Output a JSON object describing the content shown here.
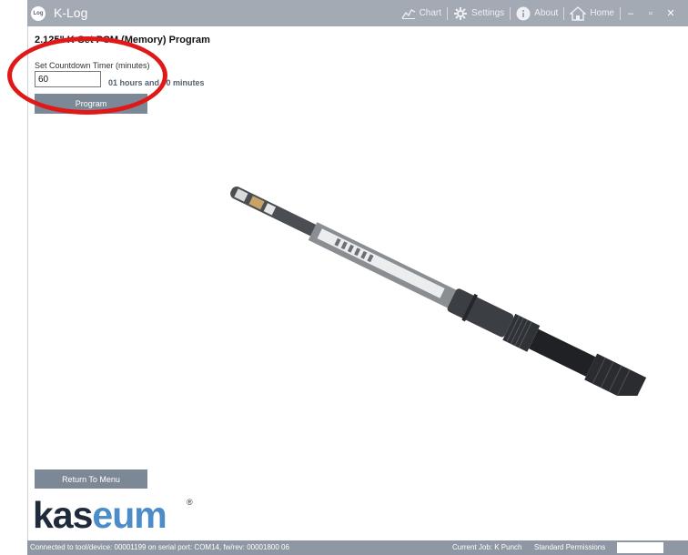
{
  "app": {
    "logo_text": "Log",
    "title": "K-Log"
  },
  "nav": {
    "chart": "Chart",
    "settings": "Settings",
    "about": "About",
    "home": "Home",
    "minimize": "–",
    "maximize": "▫",
    "close": "✕"
  },
  "page": {
    "title": "2.125\" K-Set PCM (Memory) Program",
    "timer_label": "Set Countdown Timer (minutes)",
    "timer_value": "60",
    "duration_text": "01 hours and 00 minutes",
    "program_button": "Program",
    "return_button": "Return To Menu"
  },
  "brand": {
    "part1": "kas",
    "part2": "eum",
    "reg": "®"
  },
  "status": {
    "connection": "Connected to tool/device: 00001199 on serial port: COM14, fw/rev: 00001800 06",
    "job": "Current Job: K Punch",
    "permissions": "Standard Permissions"
  },
  "colors": {
    "titlebar": "#a3aab4",
    "button": "#7d8897",
    "statusbar": "#8e97a3",
    "annotation": "#e01818",
    "brand_dark": "#1f2b3a",
    "brand_blue": "#4b8cc9"
  },
  "icons": [
    "chart-icon",
    "settings-icon",
    "about-icon",
    "home-icon"
  ]
}
